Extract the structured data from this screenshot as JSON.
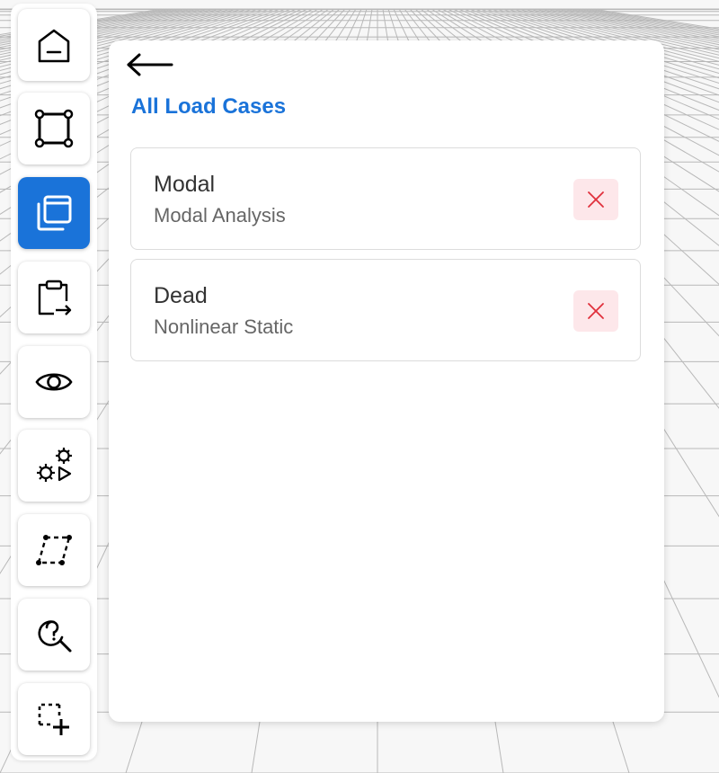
{
  "toolbar": {
    "items": [
      {
        "name": "home",
        "icon": "home-icon",
        "active": false
      },
      {
        "name": "geometry",
        "icon": "square-nodes-icon",
        "active": false
      },
      {
        "name": "load-cases",
        "icon": "layers-icon",
        "active": true
      },
      {
        "name": "export",
        "icon": "clipboard-export-icon",
        "active": false
      },
      {
        "name": "view",
        "icon": "eye-icon",
        "active": false
      },
      {
        "name": "run-analysis",
        "icon": "gears-play-icon",
        "active": false
      },
      {
        "name": "shape",
        "icon": "dashed-parallelogram-icon",
        "active": false
      },
      {
        "name": "help-search",
        "icon": "help-search-icon",
        "active": false
      },
      {
        "name": "add-selection",
        "icon": "selection-add-icon",
        "active": false
      }
    ],
    "active_color": "#1a73d9"
  },
  "panel": {
    "back_icon": "arrow-left-icon",
    "title": "All Load Cases",
    "cases": [
      {
        "name": "Modal",
        "type": "Modal Analysis",
        "delete_icon": "close-icon"
      },
      {
        "name": "Dead",
        "type": "Nonlinear Static",
        "delete_icon": "close-icon"
      }
    ]
  },
  "colors": {
    "accent": "#1a73d9",
    "delete_bg": "#fde7ea",
    "delete_icon": "#e0303c"
  }
}
